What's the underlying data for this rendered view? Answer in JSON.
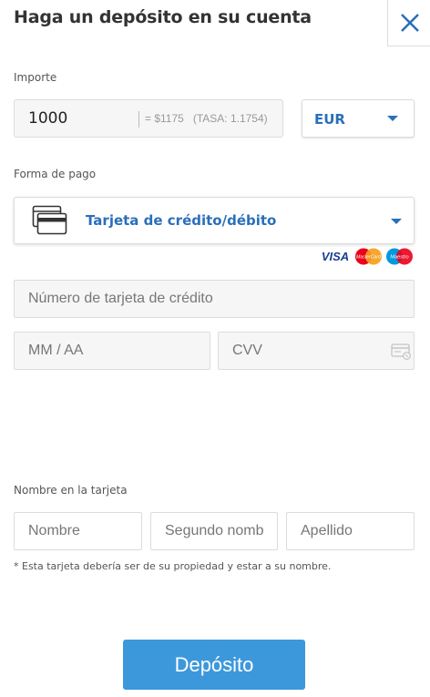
{
  "header": {
    "title": "Haga un depósito en su cuenta",
    "close_icon": "close-icon"
  },
  "amount": {
    "label": "Importe",
    "value": "1000",
    "conversion": "= $1175   (TASA: 1.1754)"
  },
  "currency": {
    "selected": "EUR"
  },
  "payment": {
    "label": "Forma de pago",
    "selected": "Tarjeta de crédito/débito",
    "icon": "credit-card-icon",
    "brands": [
      "VISA",
      "MasterCard",
      "Maestro"
    ]
  },
  "card": {
    "number_placeholder": "Número de tarjeta de crédito",
    "expiry_placeholder": "MM / AA",
    "cvv_placeholder": "CVV"
  },
  "name": {
    "label": "Nombre en la tarjeta",
    "first_placeholder": "Nombre",
    "middle_placeholder": "Segundo nombre",
    "last_placeholder": "Apellido",
    "note": "* Esta tarjeta debería ser de su propiedad y estar a su nombre."
  },
  "submit": {
    "label": "Depósito"
  },
  "colors": {
    "accent": "#2a6fba",
    "button": "#3d98db",
    "mastercard_red": "#eb001b",
    "mastercard_orange": "#f79e1b",
    "maestro_blue": "#0099df"
  }
}
